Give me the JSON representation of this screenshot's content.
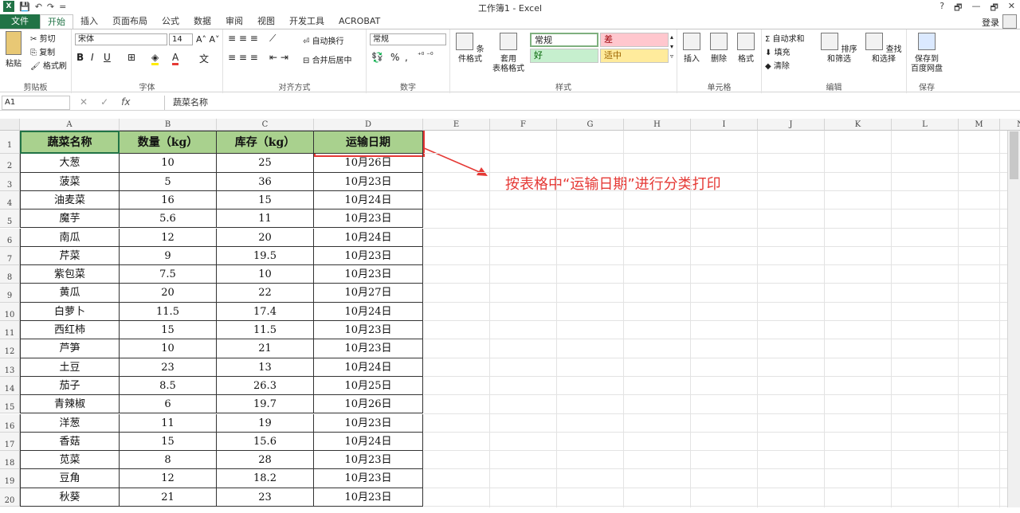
{
  "window": {
    "title": "工作簿1 - Excel",
    "help": "?",
    "controls": [
      "🗗",
      "—",
      "🗗",
      "✕"
    ]
  },
  "qat": {
    "logo": "X",
    "items": [
      "💾",
      "↶",
      "↷",
      "="
    ]
  },
  "tabs": [
    "文件",
    "开始",
    "插入",
    "页面布局",
    "公式",
    "数据",
    "审阅",
    "视图",
    "开发工具",
    "ACROBAT"
  ],
  "active_tab": "开始",
  "login": "登录",
  "ribbon": {
    "clipboard": {
      "label": "剪贴板",
      "paste": "粘贴",
      "cut": "剪切",
      "copy": "复制",
      "painter": "格式刷"
    },
    "font": {
      "label": "字体",
      "name": "宋体",
      "size": "14",
      "bold": "B",
      "italic": "I",
      "underline": "U"
    },
    "alignment": {
      "label": "对齐方式",
      "wrap": "自动换行",
      "merge": "合并后居中"
    },
    "number": {
      "label": "数字",
      "format": "常规",
      "percent": "%",
      "comma": ","
    },
    "styles": {
      "label": "样式",
      "cond": "条件格式",
      "table_fmt_1": "套用",
      "table_fmt_2": "表格格式",
      "normal": "常规",
      "bad": "差",
      "good": "好",
      "neutral": "适中"
    },
    "cells": {
      "label": "单元格",
      "insert": "插入",
      "delete": "删除",
      "format": "格式"
    },
    "editing": {
      "label": "编辑",
      "autosum": "自动求和",
      "fill": "填充",
      "clear": "清除",
      "sort": "排序和筛选",
      "find": "查找和选择"
    },
    "save": {
      "label": "保存",
      "save_to_1": "保存到",
      "save_to_2": "百度网盘"
    }
  },
  "formula_bar": {
    "name_box": "A1",
    "fx": "fx",
    "content": "蔬菜名称"
  },
  "columns": [
    "A",
    "B",
    "C",
    "D",
    "E",
    "F",
    "G",
    "H",
    "I",
    "J",
    "K",
    "L",
    "M",
    "N"
  ],
  "table": {
    "headers": [
      "蔬菜名称",
      "数量（kg）",
      "库存（kg）",
      "运输日期"
    ],
    "rows": [
      [
        "大葱",
        "10",
        "25",
        "10月26日"
      ],
      [
        "菠菜",
        "5",
        "36",
        "10月23日"
      ],
      [
        "油麦菜",
        "16",
        "15",
        "10月24日"
      ],
      [
        "魔芋",
        "5.6",
        "11",
        "10月23日"
      ],
      [
        "南瓜",
        "12",
        "20",
        "10月24日"
      ],
      [
        "芹菜",
        "9",
        "19.5",
        "10月23日"
      ],
      [
        "紫包菜",
        "7.5",
        "10",
        "10月23日"
      ],
      [
        "黄瓜",
        "20",
        "22",
        "10月27日"
      ],
      [
        "白萝卜",
        "11.5",
        "17.4",
        "10月24日"
      ],
      [
        "西红柿",
        "15",
        "11.5",
        "10月23日"
      ],
      [
        "芦笋",
        "10",
        "21",
        "10月23日"
      ],
      [
        "土豆",
        "23",
        "13",
        "10月24日"
      ],
      [
        "茄子",
        "8.5",
        "26.3",
        "10月25日"
      ],
      [
        "青辣椒",
        "6",
        "19.7",
        "10月26日"
      ],
      [
        "洋葱",
        "11",
        "19",
        "10月23日"
      ],
      [
        "香菇",
        "15",
        "15.6",
        "10月24日"
      ],
      [
        "苋菜",
        "8",
        "28",
        "10月23日"
      ],
      [
        "豆角",
        "12",
        "18.2",
        "10月23日"
      ],
      [
        "秋葵",
        "21",
        "23",
        "10月23日"
      ]
    ]
  },
  "row_numbers": [
    "1",
    "2",
    "3",
    "4",
    "5",
    "6",
    "7",
    "8",
    "9",
    "10",
    "11",
    "12",
    "13",
    "14",
    "15",
    "16",
    "17",
    "18",
    "19",
    "20"
  ],
  "annotation": {
    "text": "按表格中“运输日期”进行分类打印",
    "color": "#e53935"
  },
  "colors": {
    "accent": "#217346",
    "header_fill": "#a9d18e"
  }
}
